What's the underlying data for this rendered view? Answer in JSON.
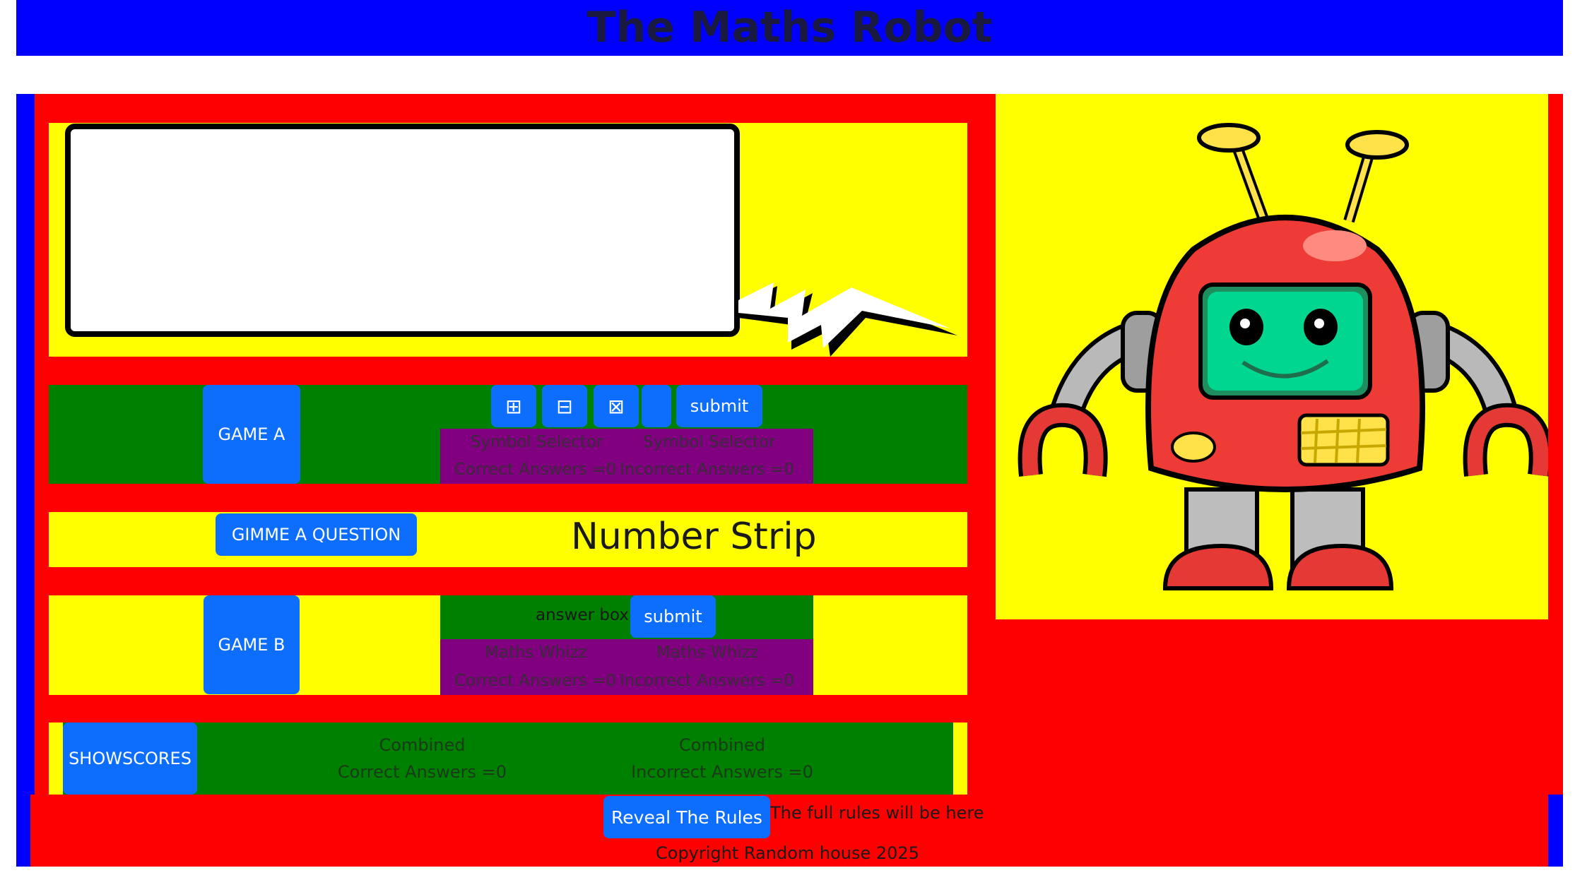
{
  "header": {
    "title": "The Maths Robot"
  },
  "game_a": {
    "button_label": "GAME A",
    "symbols": [
      {
        "glyph": "⊞",
        "icon": "plus-square-icon"
      },
      {
        "glyph": "⊟",
        "icon": "minus-square-icon"
      },
      {
        "glyph": "⊠",
        "icon": "times-square-icon"
      },
      {
        "glyph": "",
        "icon": "blank-icon"
      }
    ],
    "submit_label": "submit",
    "correct_title": "Symbol Selector",
    "correct_label": "Correct Answers =0",
    "incorrect_title": "Symbol Selector",
    "incorrect_label": "Incorrect Answers =0"
  },
  "question": {
    "button_label": "GIMME A QUESTION",
    "strip_label": "Number Strip"
  },
  "game_b": {
    "button_label": "GAME B",
    "answer_placeholder": "answer box",
    "submit_label": "submit",
    "correct_title": "Maths Whizz",
    "correct_label": "Correct Answers =0",
    "incorrect_title": "Maths Whizz",
    "incorrect_label": "Incorrect Answers =0"
  },
  "scores": {
    "button_line1": "SHOW",
    "button_line2": "SCORES",
    "correct_title": "Combined",
    "correct_label": "Correct Answers =0",
    "incorrect_title": "Combined",
    "incorrect_label": "Incorrect Answers =0"
  },
  "footer": {
    "rules_button": "Reveal The Rules",
    "rules_text": "The full rules will be here",
    "copyright": "Copyright Random house 2025"
  },
  "colors": {
    "header_bg": "#0000ff",
    "main_bg": "#ff0000",
    "panel_yellow": "#ffff00",
    "panel_green": "#008000",
    "panel_purple": "#800080",
    "button_blue": "#0d6efd"
  }
}
